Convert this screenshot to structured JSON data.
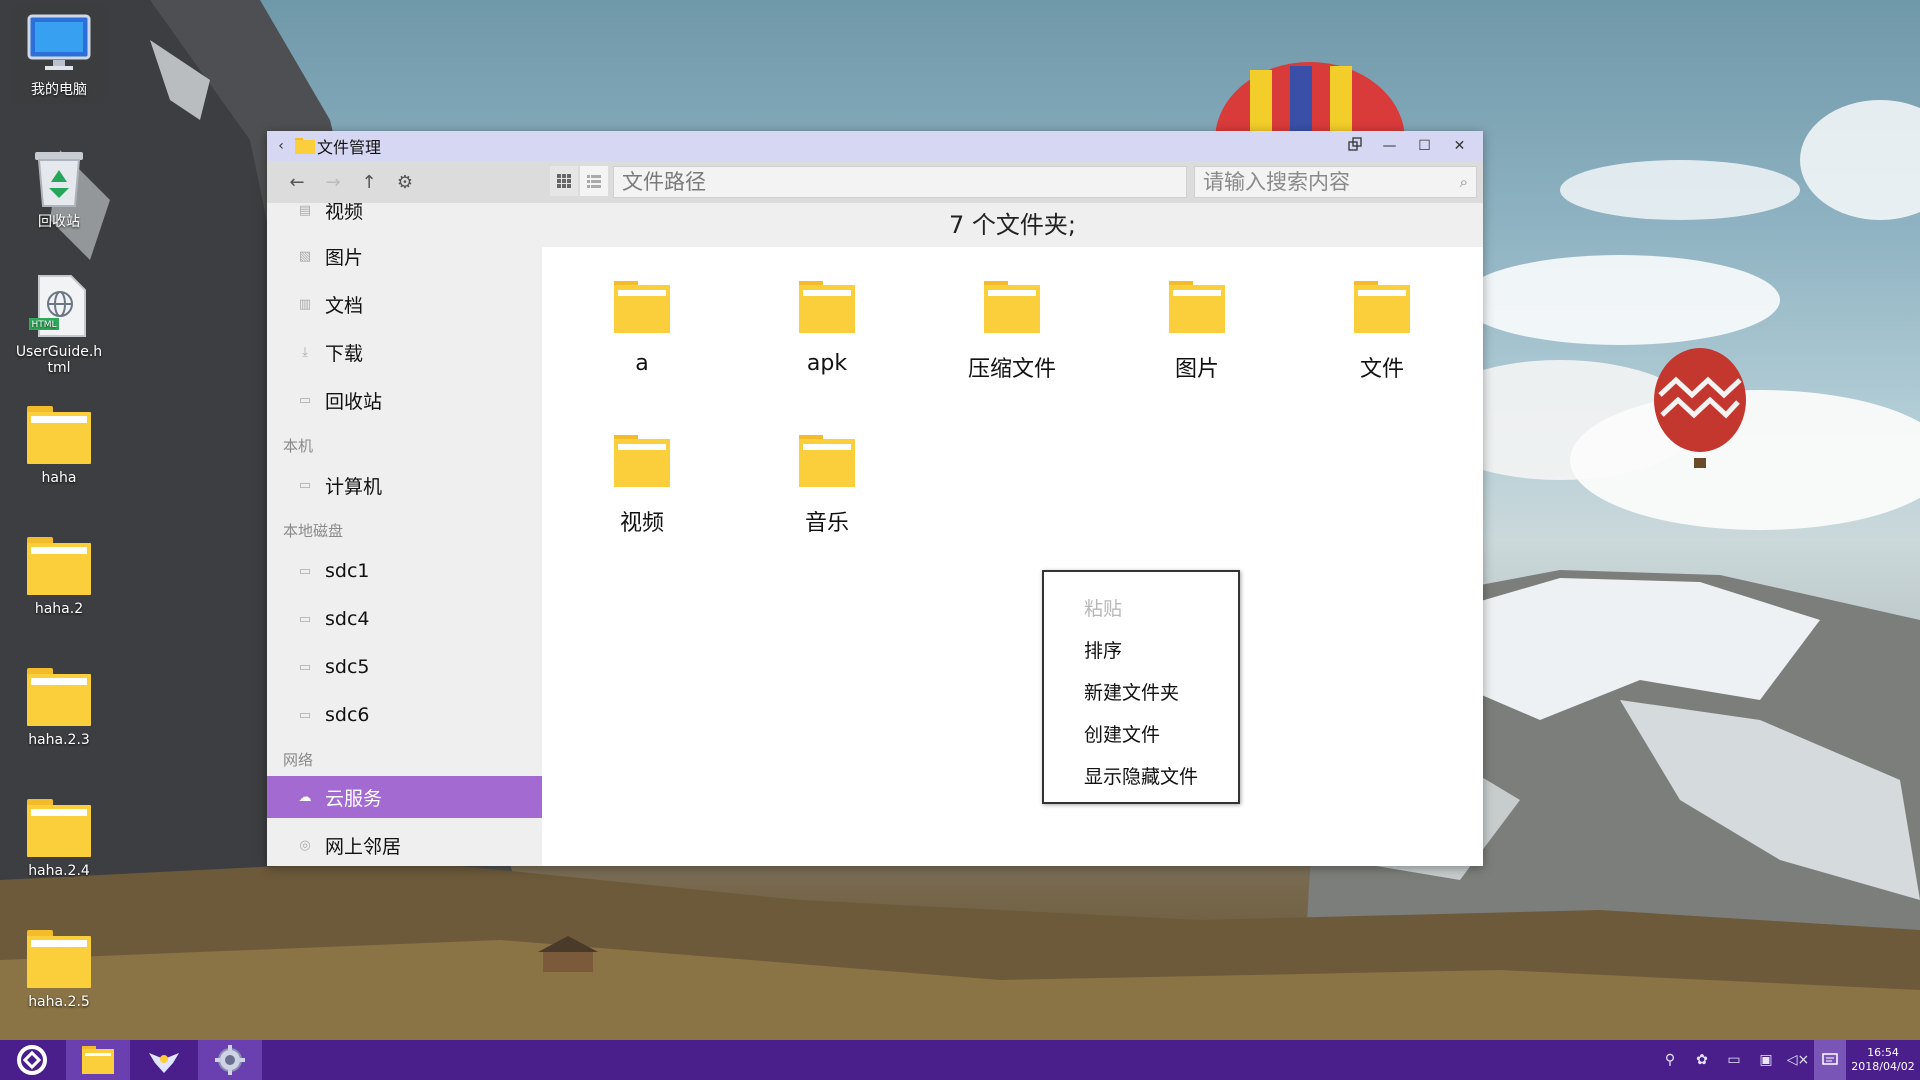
{
  "desktop": {
    "icons": [
      {
        "label": "我的电脑"
      },
      {
        "label": "回收站"
      },
      {
        "label": "UserGuide.html",
        "badge": "HTML"
      },
      {
        "label": "haha"
      },
      {
        "label": "haha.2"
      },
      {
        "label": "haha.2.3"
      },
      {
        "label": "haha.2.4"
      },
      {
        "label": "haha.2.5"
      }
    ]
  },
  "window": {
    "title": "文件管理",
    "controls": {
      "tablet": "tablet-mode-icon",
      "minimize": "—",
      "maximize": "☐",
      "close": "✕"
    },
    "toolbar": {
      "path_placeholder": "文件路径",
      "search_placeholder": "请输入搜索内容"
    },
    "sidebar": {
      "items_top": [
        {
          "label": "视频",
          "icon": "video-icon"
        },
        {
          "label": "图片",
          "icon": "picture-icon"
        },
        {
          "label": "文档",
          "icon": "document-icon"
        },
        {
          "label": "下载",
          "icon": "download-icon"
        },
        {
          "label": "回收站",
          "icon": "trash-icon"
        }
      ],
      "section_local": "本机",
      "computer": {
        "label": "计算机",
        "icon": "computer-icon"
      },
      "section_disks": "本地磁盘",
      "disks": [
        {
          "label": "sdc1"
        },
        {
          "label": "sdc4"
        },
        {
          "label": "sdc5"
        },
        {
          "label": "sdc6"
        }
      ],
      "section_network": "网络",
      "network": [
        {
          "label": "云服务",
          "icon": "cloud-icon",
          "active": true
        },
        {
          "label": "网上邻居",
          "icon": "network-neighborhood-icon"
        }
      ]
    },
    "main": {
      "status": "7 个文件夹;",
      "folders": [
        {
          "name": "a"
        },
        {
          "name": "apk"
        },
        {
          "name": "压缩文件"
        },
        {
          "name": "图片"
        },
        {
          "name": "文件"
        },
        {
          "name": "视频"
        },
        {
          "name": "音乐"
        }
      ]
    },
    "context_menu": {
      "items": [
        {
          "label": "粘贴",
          "disabled": true
        },
        {
          "label": "排序"
        },
        {
          "label": "新建文件夹"
        },
        {
          "label": "创建文件"
        },
        {
          "label": "显示隐藏文件"
        }
      ]
    }
  },
  "taskbar": {
    "apps": [
      "start-menu-icon",
      "file-manager-icon",
      "bird-app-icon",
      "settings-gear-icon"
    ],
    "clock": {
      "time": "16:54",
      "date": "2018/04/02"
    }
  },
  "colors": {
    "accent": "#a36bd1",
    "taskbar": "#4a1f8c",
    "titlebar": "#d6d8f3",
    "folder": "#fbcf3c"
  }
}
